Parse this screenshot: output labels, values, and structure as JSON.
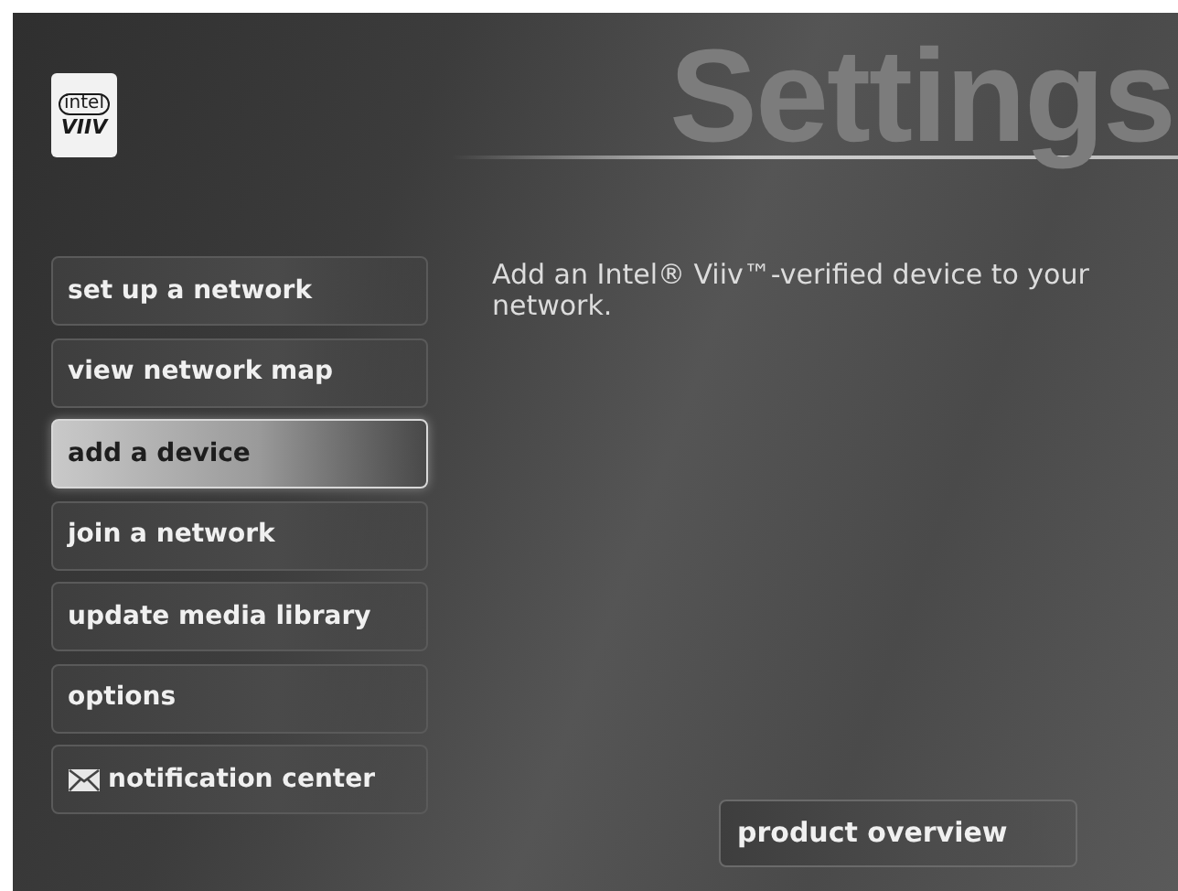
{
  "logo": {
    "top": "intel",
    "bottom": "VIIV"
  },
  "title": "Settings",
  "menu": [
    {
      "label": "set up a network",
      "kind": "plain",
      "selected": false
    },
    {
      "label": "view network map",
      "kind": "plain",
      "selected": false
    },
    {
      "label": "add a device",
      "kind": "plain",
      "selected": true
    },
    {
      "label": "join a network",
      "kind": "plain",
      "selected": false
    },
    {
      "label": "update media library",
      "kind": "plain",
      "selected": false
    },
    {
      "label": "options",
      "kind": "plain",
      "selected": false
    },
    {
      "label": "notification center",
      "kind": "mail",
      "selected": false
    }
  ],
  "description": "Add an Intel® Viiv™-verified device to your network.",
  "footer_button": "product overview"
}
